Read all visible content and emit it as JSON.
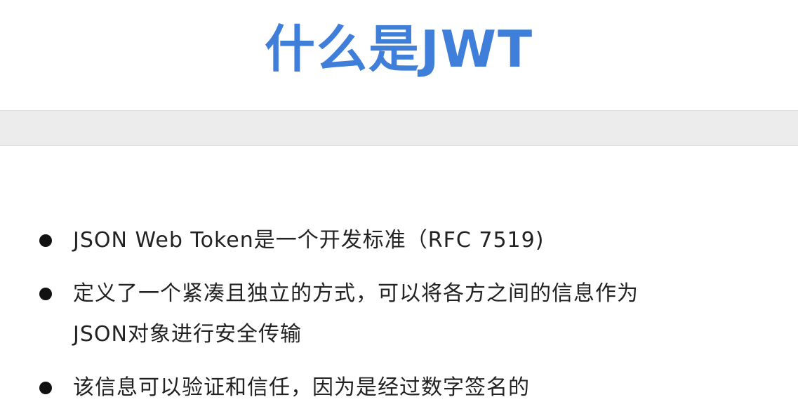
{
  "slide": {
    "title": "什么是JWT",
    "bullets": [
      {
        "lines": [
          "JSON Web Token是一个开发标准（RFC 7519)"
        ]
      },
      {
        "lines": [
          "定义了一个紧凑且独立的方式，可以将各方之间的信息作为",
          "JSON对象进行安全传输"
        ]
      },
      {
        "lines": [
          "该信息可以验证和信任，因为是经过数字签名的"
        ]
      }
    ]
  }
}
